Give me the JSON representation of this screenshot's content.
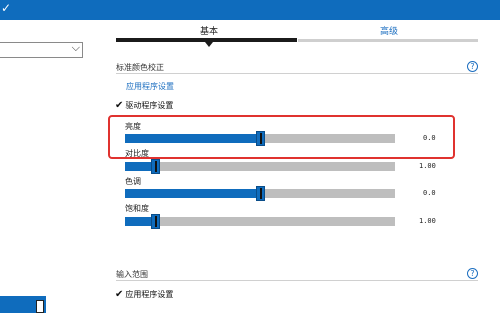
{
  "header": {
    "check_glyph": "✓"
  },
  "tabs": [
    {
      "label": "基本",
      "active": true
    },
    {
      "label": "高级",
      "active": false
    }
  ],
  "color_section": {
    "title": "标准颜色校正",
    "help": "?",
    "link_label": "应用程序设置",
    "checkbox_label": "驱动程序设置",
    "checked": true
  },
  "sliders": [
    {
      "label": "亮度",
      "value_text": "0.0",
      "level_percent": 50
    },
    {
      "label": "对比度",
      "value_text": "1.00",
      "level_percent": 11
    },
    {
      "label": "色调",
      "value_text": "0.0",
      "level_percent": 50
    },
    {
      "label": "饱和度",
      "value_text": "1.00",
      "level_percent": 11
    }
  ],
  "input_section": {
    "title": "输入范围",
    "help": "?",
    "checkbox_label": "应用程序设置",
    "checked": true
  },
  "colors": {
    "accent": "#0f6cbd",
    "track": "#bebebe",
    "highlight": "#e0322f"
  }
}
